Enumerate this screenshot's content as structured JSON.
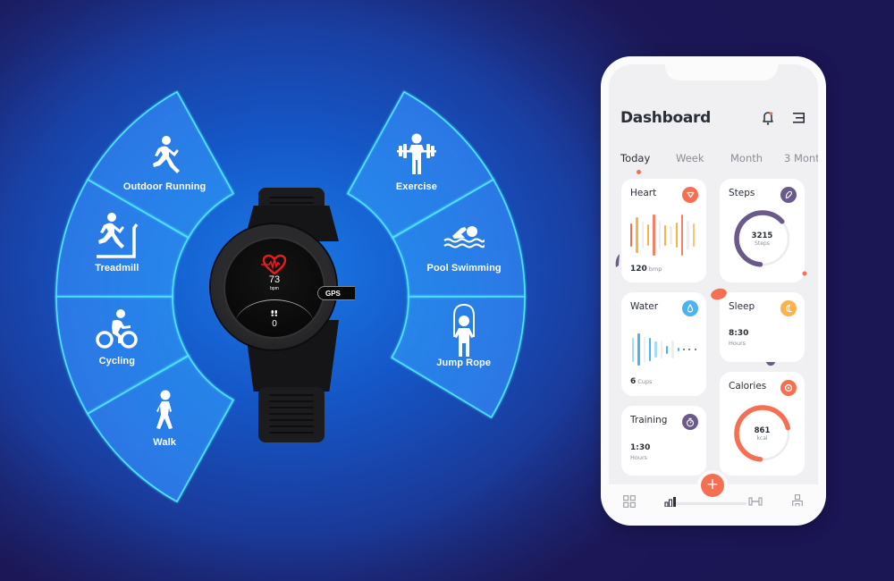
{
  "colors": {
    "accent_orange": "#f56f52",
    "accent_purple": "#6a5a8c",
    "accent_blue": "#4ab3f0",
    "accent_yellow": "#fbb24c",
    "segment_stroke": "#4fe6ff",
    "text_dark": "#2a2e38",
    "text_muted": "#8a8d96"
  },
  "activity_wheel": {
    "left_segments": [
      {
        "label": "Outdoor Running",
        "icon": "running-icon"
      },
      {
        "label": "Treadmill",
        "icon": "treadmill-icon"
      },
      {
        "label": "Cycling",
        "icon": "cycling-icon"
      },
      {
        "label": "Walk",
        "icon": "walk-icon"
      }
    ],
    "right_segments": [
      {
        "label": "Exercise",
        "icon": "weightlifting-icon"
      },
      {
        "label": "Pool Swimming",
        "icon": "swimming-icon"
      },
      {
        "label": "Jump Rope",
        "icon": "jump-rope-icon"
      }
    ]
  },
  "watch": {
    "heart_icon": "heart-pulse-icon",
    "bpm_value": "73",
    "bpm_unit": "bpm",
    "gps_label": "GPS",
    "steps_icon": "footsteps-icon",
    "steps_value": "0"
  },
  "phone": {
    "title": "Dashboard",
    "header_icons": [
      "bell-icon",
      "menu-icon"
    ],
    "tabs": [
      {
        "label": "Today",
        "active": true
      },
      {
        "label": "Week",
        "active": false
      },
      {
        "label": "Month",
        "active": false
      },
      {
        "label": "3 Mont",
        "active": false
      }
    ],
    "cards": {
      "heart": {
        "title": "Heart",
        "value": "120",
        "unit": "bmp",
        "icon": "heart-icon",
        "bars": [
          {
            "h": 0.55,
            "c": "#f56f52"
          },
          {
            "h": 0.85,
            "c": "#fbb24c"
          },
          {
            "h": 0.65,
            "c": "#eeeeee"
          },
          {
            "h": 0.52,
            "c": "#fbb24c"
          },
          {
            "h": 1.0,
            "c": "#f57f67"
          },
          {
            "h": 0.7,
            "c": "#eeeeee"
          },
          {
            "h": 0.5,
            "c": "#fbb24c"
          },
          {
            "h": 0.42,
            "c": "#eeeeee"
          },
          {
            "h": 0.6,
            "c": "#fbb24c"
          },
          {
            "h": 1.0,
            "c": "#f57f67"
          },
          {
            "h": 0.7,
            "c": "#eeeeee"
          },
          {
            "h": 0.55,
            "c": "#fcc27a"
          }
        ]
      },
      "steps": {
        "title": "Steps",
        "value": "3215",
        "unit": "Steps",
        "icon": "shoe-icon",
        "progress": 0.62
      },
      "water": {
        "title": "Water",
        "value": "6",
        "unit": "Cups",
        "icon": "water-drop-icon",
        "bars": [
          {
            "h": 0.75,
            "c": "#a7dcf8"
          },
          {
            "h": 1.0,
            "c": "#4ab3f0"
          },
          {
            "h": 0.78,
            "c": "#eeeeee"
          },
          {
            "h": 0.7,
            "c": "#4ab3f0"
          },
          {
            "h": 0.5,
            "c": "#a7dcf8"
          },
          {
            "h": 0.55,
            "c": "#eeeeee"
          },
          {
            "h": 0.25,
            "c": "#4ab3f0"
          },
          {
            "h": 0.55,
            "c": "#eeeeee"
          },
          {
            "h": 0.12,
            "c": "#4ab3f0"
          },
          {
            "h": 0.04,
            "c": "#555555"
          },
          {
            "h": 0.04,
            "c": "#555555"
          },
          {
            "h": 0.04,
            "c": "#555555"
          }
        ]
      },
      "sleep": {
        "title": "Sleep",
        "value": "8:30",
        "unit": "Hours",
        "icon": "moon-icon"
      },
      "training": {
        "title": "Training",
        "value": "1:30",
        "unit": "Hours",
        "icon": "stopwatch-icon"
      },
      "calories": {
        "title": "Calories",
        "value": "861",
        "unit": "kcal",
        "icon": "target-icon",
        "progress": 0.7
      }
    },
    "bottom_nav": [
      {
        "icon": "grid-icon"
      },
      {
        "icon": "bar-chart-icon"
      },
      {
        "icon": "add-icon",
        "label": "+"
      },
      {
        "icon": "dumbbell-icon"
      },
      {
        "icon": "profile-icon"
      }
    ]
  }
}
